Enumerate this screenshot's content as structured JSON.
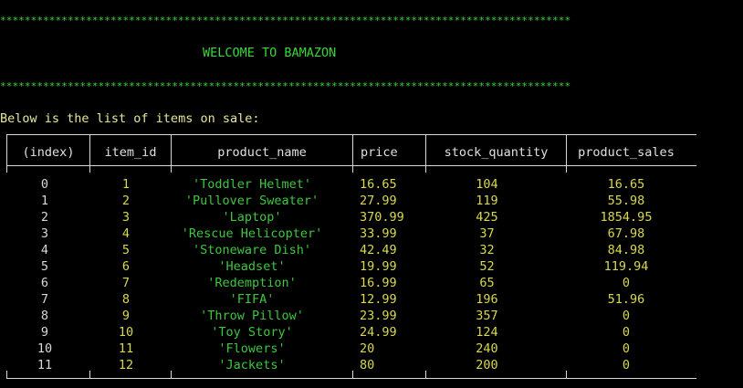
{
  "banner": {
    "stars": "*********************************************************************************************",
    "welcome": "WELCOME TO BAMAZON"
  },
  "intro": "Below is the list of items on sale:",
  "table": {
    "columns": [
      "(index)",
      "item_id",
      "product_name",
      "price",
      "stock_quantity",
      "product_sales"
    ],
    "rows": [
      [
        "0",
        "1",
        "'Toddler Helmet'",
        "16.65",
        "104",
        "16.65"
      ],
      [
        "1",
        "2",
        "'Pullover Sweater'",
        "27.99",
        "119",
        "55.98"
      ],
      [
        "2",
        "3",
        "'Laptop'",
        "370.99",
        "425",
        "1854.95"
      ],
      [
        "3",
        "4",
        "'Rescue Helicopter'",
        "33.99",
        "37",
        "67.98"
      ],
      [
        "4",
        "5",
        "'Stoneware Dish'",
        "42.49",
        "32",
        "84.98"
      ],
      [
        "5",
        "6",
        "'Headset'",
        "19.99",
        "52",
        "119.94"
      ],
      [
        "6",
        "7",
        "'Redemption'",
        "16.99",
        "65",
        "0"
      ],
      [
        "7",
        "8",
        "'FIFA'",
        "12.99",
        "196",
        "51.96"
      ],
      [
        "8",
        "9",
        "'Throw Pillow'",
        "23.99",
        "357",
        "0"
      ],
      [
        "9",
        "10",
        "'Toy Story'",
        "24.99",
        "124",
        "0"
      ],
      [
        "10",
        "11",
        "'Flowers'",
        "20",
        "240",
        "0"
      ],
      [
        "11",
        "12",
        "'Jackets'",
        "80",
        "200",
        "0"
      ]
    ]
  },
  "colors": {
    "background": "#000000",
    "banner_green": "#3ad63a",
    "intro_yellow": "#e8e89a",
    "number_yellow": "#d8d850",
    "string_green": "#3ec63e"
  }
}
